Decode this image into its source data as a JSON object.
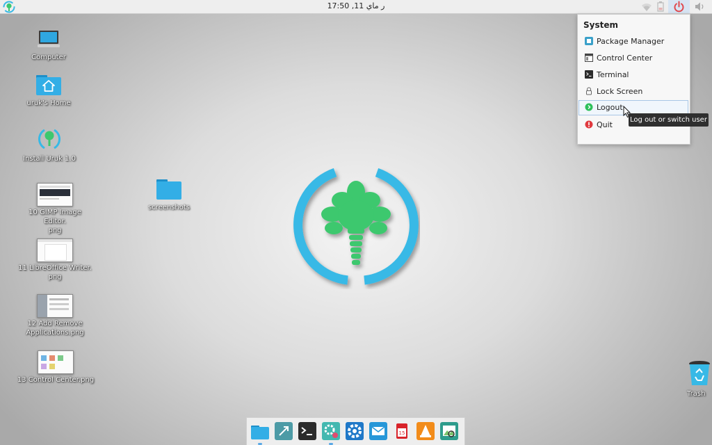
{
  "top_panel": {
    "clock": "ر ماي 11, 17:50",
    "icons": [
      "uruk-logo-icon",
      "wifi-icon",
      "battery-icon",
      "power-icon",
      "volume-icon"
    ]
  },
  "desktop": {
    "icons": [
      {
        "label": "Computer",
        "icon": "computer-icon"
      },
      {
        "label": "uruk's Home",
        "icon": "home-folder-icon"
      },
      {
        "label": "Install Uruk 1.0",
        "icon": "install-icon"
      },
      {
        "label": "10 GIMP Image Editor.\npng",
        "icon": "image-thumbnail"
      },
      {
        "label": "screenshots",
        "icon": "folder-icon"
      },
      {
        "label": "11 LibreOffice Writer.\npng",
        "icon": "image-thumbnail"
      },
      {
        "label": "12 Add Remove\nApplications.png",
        "icon": "image-thumbnail"
      },
      {
        "label": "13 Control Center.png",
        "icon": "image-thumbnail"
      }
    ],
    "trash_label": "Trash"
  },
  "system_menu": {
    "title": "System",
    "items": [
      {
        "label": "Package Manager",
        "icon": "package-manager-icon"
      },
      {
        "label": "Control Center",
        "icon": "control-center-icon"
      },
      {
        "label": "Terminal",
        "icon": "terminal-icon"
      },
      {
        "label": "Lock Screen",
        "icon": "lock-icon"
      },
      {
        "label": "Logout",
        "icon": "logout-icon"
      },
      {
        "label": "Quit",
        "icon": "quit-icon"
      }
    ],
    "hovered": "Logout"
  },
  "tooltip": "Log out or switch user",
  "dock": {
    "items": [
      "files-icon",
      "launcher-icon",
      "terminal-icon",
      "settings-icon",
      "system-settings-icon",
      "mail-icon",
      "calendar-icon",
      "vlc-icon",
      "image-viewer-icon"
    ],
    "calendar_day": "15"
  },
  "colors": {
    "accent": "#37b9e6",
    "logo_green": "#3cc86e",
    "power_red": "#e0474c"
  }
}
